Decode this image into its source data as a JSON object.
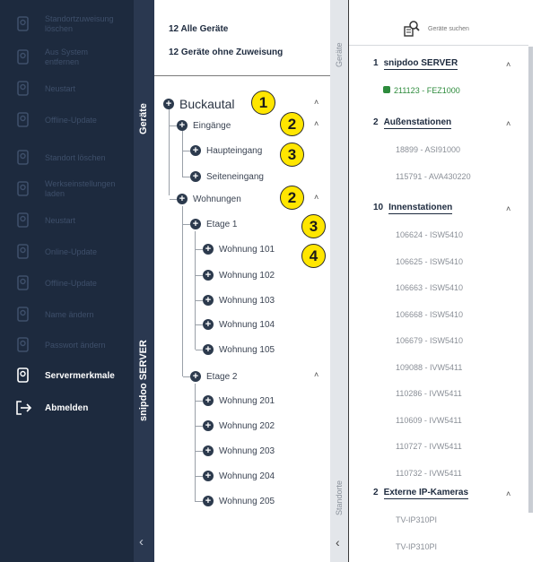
{
  "sidebar": {
    "vertical_top_label": "Geräte",
    "vertical_bottom_label": "snipdoo SERVER",
    "collapse_icon": "chevron-left-icon",
    "items": [
      {
        "label": "Standortzuweisung\nlöschen",
        "icon": "device-location-icon",
        "active": false
      },
      {
        "label": "Aus System\nentfernen",
        "icon": "remove-device-icon",
        "active": false
      },
      {
        "label": "Neustart",
        "icon": "device-restart-icon",
        "active": false
      },
      {
        "label": "Offline-Update",
        "icon": "device-update-icon",
        "active": false
      },
      {
        "label": "Standort löschen",
        "icon": "location-pin-icon",
        "active": false
      },
      {
        "label": "Werkseinstellungen\nladen",
        "icon": "factory-reset-icon",
        "active": false
      },
      {
        "label": "Neustart",
        "icon": "power-icon",
        "active": false
      },
      {
        "label": "Online-Update",
        "icon": "online-update-icon",
        "active": false
      },
      {
        "label": "Offline-Update",
        "icon": "offline-update-icon",
        "active": false
      },
      {
        "label": "Name ändern",
        "icon": "rename-icon",
        "active": false
      },
      {
        "label": "Passwort ändern",
        "icon": "password-icon",
        "active": false
      },
      {
        "label": "Servermerkmale",
        "icon": "server-features-icon",
        "active": true
      },
      {
        "label": "Abmelden",
        "icon": "logout-icon",
        "active": true
      }
    ]
  },
  "tree": {
    "all_devices": "12  Alle Geräte",
    "unassigned_devices": "12  Geräte ohne Zuweisung",
    "strip_top_label": "Geräte",
    "strip_bottom_label": "Standorte",
    "collapse_icon": "chevron-left-icon",
    "root": "Buckautal",
    "nodes": {
      "eingaenge": "Eingänge",
      "haupteingang": "Haupteingang",
      "seiteneingang": "Seiteneingang",
      "wohnungen": "Wohnungen",
      "etage1": "Etage 1",
      "etage2": "Etage 2",
      "w101": "Wohnung 101",
      "w102": "Wohnung 102",
      "w103": "Wohnung 103",
      "w104": "Wohnung 104",
      "w105": "Wohnung 105",
      "w201": "Wohnung 201",
      "w202": "Wohnung 202",
      "w203": "Wohnung 203",
      "w204": "Wohnung 204",
      "w205": "Wohnung 205"
    },
    "markers": [
      "1",
      "2",
      "3",
      "2",
      "3",
      "4"
    ]
  },
  "devices": {
    "search_label": "Geräte suchen",
    "groups": [
      {
        "count": "1",
        "name": "snipdoo SERVER",
        "items": [
          "211123 - FEZ1000"
        ],
        "online_first": true
      },
      {
        "count": "2",
        "name": "Außenstationen",
        "items": [
          "18899 - ASI91000",
          "115791 - AVA430220"
        ],
        "online_first": false
      },
      {
        "count": "10",
        "name": "Innenstationen",
        "items": [
          "106624 - ISW5410",
          "106625 - ISW5410",
          "106663 - ISW5410",
          "106668 - ISW5410",
          "106679 - ISW5410",
          "109088 - IVW5411",
          "110286 - IVW5411",
          "110609 - IVW5411",
          "110727 - IVW5411",
          "110732 - IVW5411"
        ],
        "online_first": false
      },
      {
        "count": "2",
        "name": "Externe IP-Kameras",
        "items": [
          "TV-IP310PI",
          "TV-IP310PI"
        ],
        "online_first": false
      }
    ]
  }
}
